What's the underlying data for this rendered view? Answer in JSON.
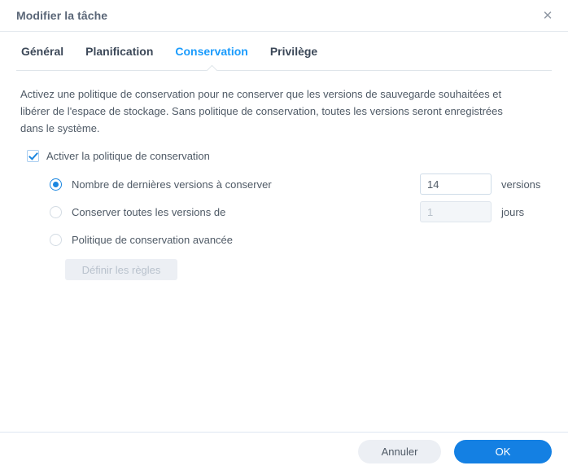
{
  "window": {
    "title": "Modifier la tâche",
    "close_icon": "close-icon",
    "close_glyph": "✕"
  },
  "tabs": [
    {
      "label": "Général",
      "active": false
    },
    {
      "label": "Planification",
      "active": false
    },
    {
      "label": "Conservation",
      "active": true
    },
    {
      "label": "Privilège",
      "active": false
    }
  ],
  "main": {
    "description": "Activez une politique de conservation pour ne conserver que les versions de sauvegarde souhaitées et libérer de l'espace de stockage. Sans politique de conservation, toutes les versions seront enregistrées dans le système.",
    "enable_checkbox": {
      "label": "Activer la politique de conservation",
      "checked": true
    },
    "options": [
      {
        "label": "Nombre de dernières versions à conserver",
        "selected": true,
        "field": {
          "value": "14",
          "unit": "versions",
          "disabled": false
        }
      },
      {
        "label": "Conserver toutes les versions de",
        "selected": false,
        "field": {
          "value": "1",
          "unit": "jours",
          "disabled": true
        }
      },
      {
        "label": "Politique de conservation avancée",
        "selected": false
      }
    ],
    "rules_button": {
      "label": "Définir les règles",
      "disabled": true
    }
  },
  "footer": {
    "cancel_label": "Annuler",
    "ok_label": "OK"
  },
  "colors": {
    "accent_blue": "#1a9bfc",
    "primary_button": "#1480e3",
    "control_blue": "#1a86e0",
    "text": "#4f5a66",
    "title_text": "#5a6677",
    "tab_text": "#3c4858",
    "disabled_text": "#b9c2cd",
    "border": "#dfe5ea"
  }
}
